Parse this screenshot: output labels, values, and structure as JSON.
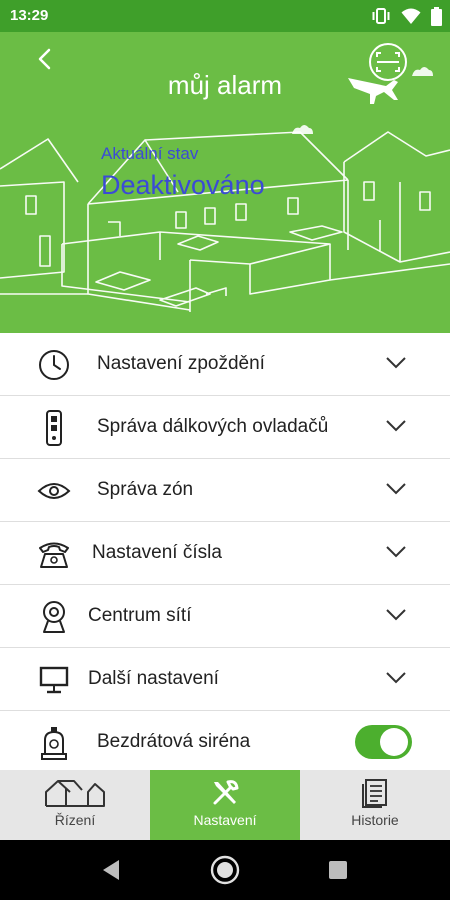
{
  "status_bar": {
    "time": "13:29",
    "icons": [
      "vibrate-icon",
      "wifi-icon",
      "battery-icon"
    ]
  },
  "header": {
    "title": "můj alarm",
    "state_label": "Aktuální stav",
    "state_value": "Deaktivováno"
  },
  "menu": {
    "items": [
      {
        "label": "Nastavení zpoždění",
        "icon": "clock-icon"
      },
      {
        "label": "Správa dálkových ovladačů",
        "icon": "remote-control-icon"
      },
      {
        "label": "Správa zón",
        "icon": "eye-icon"
      },
      {
        "label": "Nastavení čísla",
        "icon": "telephone-icon"
      },
      {
        "label": "Centrum sítí",
        "icon": "webcam-icon"
      },
      {
        "label": "Další nastavení",
        "icon": "monitor-icon"
      }
    ],
    "siren": {
      "label": "Bezdrátová siréna",
      "icon": "siren-icon",
      "enabled": true
    }
  },
  "tabs": [
    {
      "label": "Řízení",
      "icon": "houses-icon",
      "active": false
    },
    {
      "label": "Nastavení",
      "icon": "tools-icon",
      "active": true
    },
    {
      "label": "Historie",
      "icon": "history-icon",
      "active": false
    }
  ],
  "colors": {
    "brand_green": "#6bbd45",
    "status_green": "#3f9f2a",
    "state_text": "#3b4bd6",
    "toggle_on": "#4caf2e"
  }
}
